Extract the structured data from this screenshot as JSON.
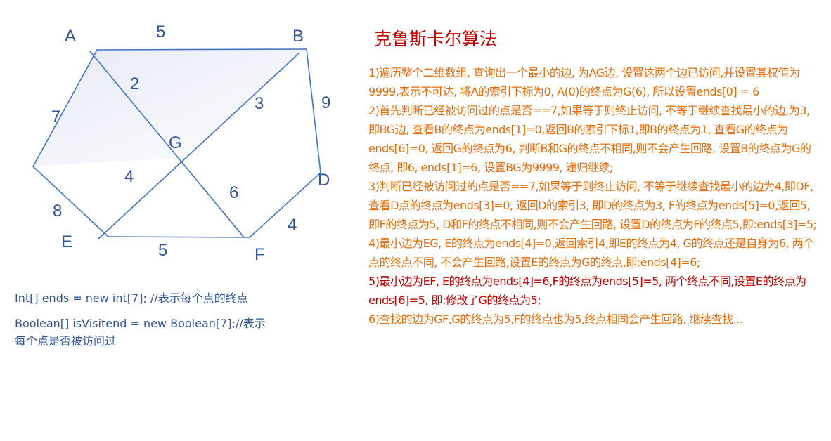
{
  "graph": {
    "nodes": {
      "A": "A",
      "B": "B",
      "G": "G",
      "D": "D",
      "E": "E",
      "F": "F"
    },
    "weights": {
      "AB": "5",
      "AG": "2",
      "BG": "3",
      "BD": "9",
      "AE": "7",
      "GE": "4",
      "GF": "6",
      "EE": "8",
      "DF": "4",
      "EF": "5"
    }
  },
  "code": {
    "ends_decl": "Int[] ends = new int[7]; //表示每个点的终点",
    "visited_decl_1": "Boolean[] isVisitend = new Boolean[7];//表示",
    "visited_decl_2": "每个点是否被访问过"
  },
  "title": "克鲁斯卡尔算法",
  "steps": [
    "1)遍历整个二维数组, 查询出一个最小的边, 为AG边, 设置这两个边已访问,并设置其权值为9999,表示不可达, 将A的索引下标为0, A(0)的终点为G(6), 所以设置ends[0] = 6",
    "2)首先判断已经被访问过的点是否==7,如果等于则终止访问, 不等于继续查找最小的边,为3,即BG边, 查看B的终点为ends[1]=0,返回B的索引下标1,即B的终点为1, 查看G的终点为ends[6]=0, 返回G的终点为6, 判断B和G的终点不相同,则不会产生回路, 设置B的终点为G的终点, 即6, ends[1]=6, 设置BG为9999, 递归继续;",
    "3)判断已经被访问过的点是否==7,如果等于则终止访问, 不等于继续查找最小的边为4,即DF,查看D点的终点为ends[3]=0, 返回D的索引3, 即D的终点为3, F的终点为ends[5]=0,返回5, 即F的终点为5, D和F的终点不相同,则不会产生回路, 设置D的终点为F的终点5,即:ends[3]=5;",
    "4)最小边为EG, E的终点为ends[4]=0,返回索引4,即E的终点为4, G的终点还是自身为6, 两个点的终点不同, 不会产生回路,设置E的终点为G的终点,即:ends[4]=6;",
    "5)最小边为EF, E的终点为ends[4]=6,F的终点为ends[5]=5, 两个终点不同,设置E的终点为ends[6]=5, 即:修改了G的终点为5;",
    "6)查找的边为GF,G的终点为5,F的终点也为5,终点相同会产生回路, 继续查找..."
  ],
  "colors": {
    "edge": "#4472c4",
    "label": "#2f5597",
    "title": "#c00000",
    "step_text": "#e46c0a",
    "step_highlight": "#c00000",
    "fill_light": "#eef0f9"
  }
}
